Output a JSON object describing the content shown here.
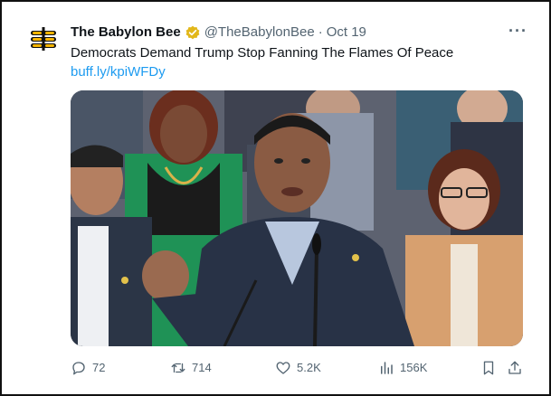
{
  "tweet": {
    "author_name": "The Babylon Bee",
    "handle": "@TheBabylonBee",
    "separator": "·",
    "date": "Oct 19",
    "more": "···",
    "text": "Democrats Demand Trump Stop Fanning The Flames Of Peace",
    "link": "buff.ly/kpiWFDy"
  },
  "actions": {
    "replies": "72",
    "retweets": "714",
    "likes": "5.2K",
    "views": "156K"
  },
  "icons": {
    "avatar": "babylon-bee-logo",
    "verified": "gold-verified-badge",
    "reply": "reply-icon",
    "retweet": "retweet-icon",
    "like": "heart-icon",
    "views": "views-chart-icon",
    "bookmark": "bookmark-icon",
    "share": "share-icon"
  },
  "colors": {
    "link": "#1d9bf0",
    "verified": "#e2b719",
    "secondary_text": "#536471"
  }
}
